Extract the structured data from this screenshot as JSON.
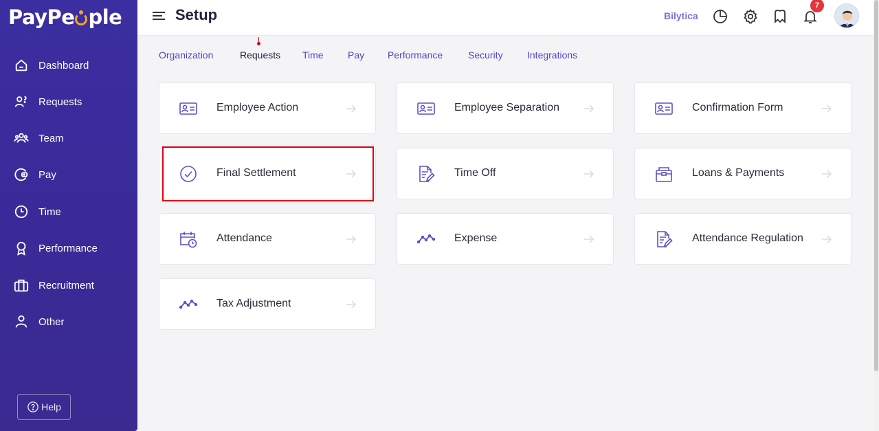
{
  "app": {
    "logo": "PayPeople"
  },
  "sidebar": {
    "items": [
      {
        "label": "Dashboard",
        "icon": "home-icon"
      },
      {
        "label": "Requests",
        "icon": "requests-icon"
      },
      {
        "label": "Team",
        "icon": "team-icon"
      },
      {
        "label": "Pay",
        "icon": "wallet-icon"
      },
      {
        "label": "Time",
        "icon": "clock-icon"
      },
      {
        "label": "Performance",
        "icon": "award-icon"
      },
      {
        "label": "Recruitment",
        "icon": "briefcase-icon"
      },
      {
        "label": "Other",
        "icon": "user-icon"
      }
    ],
    "help_label": "Help"
  },
  "header": {
    "title": "Setup",
    "company": "Bilytica",
    "notification_count": "7"
  },
  "tabs": [
    {
      "label": "Organization",
      "active": false
    },
    {
      "label": "Requests",
      "active": true
    },
    {
      "label": "Time",
      "active": false
    },
    {
      "label": "Pay",
      "active": false
    },
    {
      "label": "Performance",
      "active": false
    },
    {
      "label": "Security",
      "active": false
    },
    {
      "label": "Integrations",
      "active": false
    }
  ],
  "cards": [
    {
      "label": "Employee Action",
      "icon": "id-card-icon"
    },
    {
      "label": "Employee Separation",
      "icon": "id-card-icon"
    },
    {
      "label": "Confirmation Form",
      "icon": "id-card-icon"
    },
    {
      "label": "Final Settlement",
      "icon": "check-circle-icon"
    },
    {
      "label": "Time Off",
      "icon": "document-edit-icon"
    },
    {
      "label": "Loans & Payments",
      "icon": "wallet-box-icon"
    },
    {
      "label": "Attendance",
      "icon": "calendar-clock-icon"
    },
    {
      "label": "Expense",
      "icon": "trend-line-icon"
    },
    {
      "label": "Attendance Regulation",
      "icon": "document-edit-icon"
    },
    {
      "label": "Tax Adjustment",
      "icon": "trend-line-icon"
    }
  ],
  "colors": {
    "sidebar_bg": "#3b2ea0",
    "accent": "#4f46c8",
    "icon": "#5a52c9",
    "highlight": "#e3000f",
    "badge": "#e5343d"
  }
}
